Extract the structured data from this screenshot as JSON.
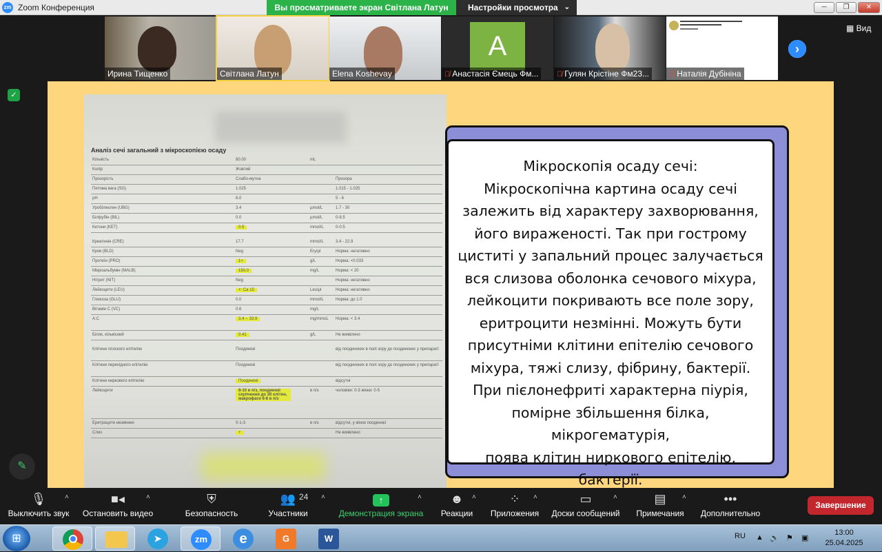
{
  "window": {
    "app_icon": "zm",
    "title": "Zoom Конференция",
    "share_banner": "Вы просматриваете экран Світлана Латун",
    "view_options": "Настройки просмотра",
    "buttons": [
      "minimize-icon",
      "restore-icon",
      "close-icon"
    ]
  },
  "participants": [
    {
      "name": "Ирина Тищенко",
      "muted": false
    },
    {
      "name": "Світлана Латун",
      "muted": false,
      "active": true
    },
    {
      "name": "Elena Koshevay",
      "muted": false
    },
    {
      "name": "Анастасія Ємець Фм...",
      "muted": true,
      "avatar_letter": "А"
    },
    {
      "name": "Гулян Крістіне Фм23...",
      "muted": true
    },
    {
      "name": "Наталія Дубініна",
      "muted": true
    }
  ],
  "view_button": "Вид",
  "slide": {
    "document_title": "Аналіз сечі загальний з мікроскопією осаду",
    "document_rows": [
      [
        "Кількість",
        "80.00",
        "mL",
        ""
      ],
      [
        "Колір",
        "Жовтий",
        "",
        ""
      ],
      [
        "Прозорість",
        "Слабо-мутна",
        "",
        "Прозора"
      ],
      [
        "Питома вага (SG)",
        "1.025",
        "",
        "1.015 - 1.025"
      ],
      [
        "pH",
        "6.0",
        "",
        "5 - 6"
      ],
      [
        "Уробіліноген (UBG)",
        "3.4",
        "µmol/L",
        "1.7 - 30"
      ],
      [
        "Білірубін (BIL)",
        "0.0",
        "µmol/L",
        "0-8.5"
      ],
      [
        "Кетони (KET)",
        "0.5",
        "mmol/L",
        "0-0.5"
      ],
      [
        "Креатинін (CRE)",
        "17.7",
        "mmol/L",
        "3.4 - 22.9"
      ],
      [
        "Кров (BLD)",
        "Neg",
        "Ery/µl",
        "Норма: негативно"
      ],
      [
        "Протеїн (PRO)",
        "1+",
        "g/L",
        "Норма: <0.033"
      ],
      [
        "Мікроальбумін (MALB)",
        "150.0",
        "mg/L",
        "Норма: < 20"
      ],
      [
        "Нітрит (NIT)",
        "Neg",
        "",
        "Норма: негативно"
      ],
      [
        "Лейкоцити (LEU)",
        "+: Ca 15",
        "Leu/µl",
        "Норма: негативно"
      ],
      [
        "Глюкоза (GLU)",
        "0.0",
        "mmol/L",
        "Норма: до 1.0"
      ],
      [
        "Вітамін С (VC)",
        "0.6",
        "mg/L",
        ""
      ],
      [
        "A:C",
        "3.4 -- 33.9",
        "mg/mmoL",
        "Норма: < 3.4"
      ],
      [
        "Білок, кількісний",
        "0.41",
        "g/L",
        "Не виявлено"
      ],
      [
        "Клітини плоского епітелію",
        "Поодинокі",
        "",
        "від поодиноких в полі зору до поодиноких у препараті"
      ],
      [
        "Клітини перехідного епітелію",
        "Поодинокі",
        "",
        "від поодиноких в полі зору до поодиноких у препараті"
      ],
      [
        "Клітини ниркового епітелію",
        "Поодинокі",
        "",
        "відсутні"
      ],
      [
        "Лейкоцити",
        "8-10 в п/з, поодинокі скупчення до 30 клітин, макрофаги 6-8 в п/з",
        "в п/з",
        "чоловіки: 0-3 жінки: 0-5"
      ],
      [
        "Еритроцити незмінені",
        "0-1-3",
        "в п/з",
        "відсутні, у жінок поодинокі"
      ],
      [
        "Слиз",
        "+",
        "",
        "Не виявлено"
      ]
    ],
    "text_lines": [
      "Мікроскопія осаду сечі:",
      "Мікроскопічна картина осаду сечі",
      "залежить від характеру захворювання,",
      "його вираженості. Так при гострому",
      "циститі у запальний процес залучається",
      "вся слизова оболонка сечового міхура,",
      "лейкоцити покривають все поле зору,",
      "еритроцити незмінні. Можуть бути",
      "присутніми клітини епітелію сечового",
      "міхура, тяжі слизу, фібрину, бактерії.",
      "При пієлонефриті характерна піурія,",
      "помірне збільшення білка, мікрогематурія,",
      "поява клітин ниркового епітелію, бактерії."
    ],
    "colors": {
      "background": "#fdd67e",
      "frame": "#8c8ed8",
      "highlight": "#e4ea3c"
    }
  },
  "toolbar": {
    "mute": "Выключить звук",
    "video": "Остановить видео",
    "security": "Безопасность",
    "participants": "Участники",
    "participants_count": "24",
    "share": "Демонстрация экрана",
    "reactions": "Реакции",
    "apps": "Приложения",
    "whiteboards": "Доски сообщений",
    "notes": "Примечания",
    "more": "Дополнительно",
    "end": "Завершение"
  },
  "taskbar": {
    "apps": [
      "chrome-icon",
      "folder-icon",
      "telegram-icon",
      "zoom-icon",
      "ie-icon",
      "pdf-icon",
      "word-icon"
    ],
    "zoom_label": "zm",
    "lang": "RU",
    "time": "13:00",
    "date": "25.04.2025"
  }
}
